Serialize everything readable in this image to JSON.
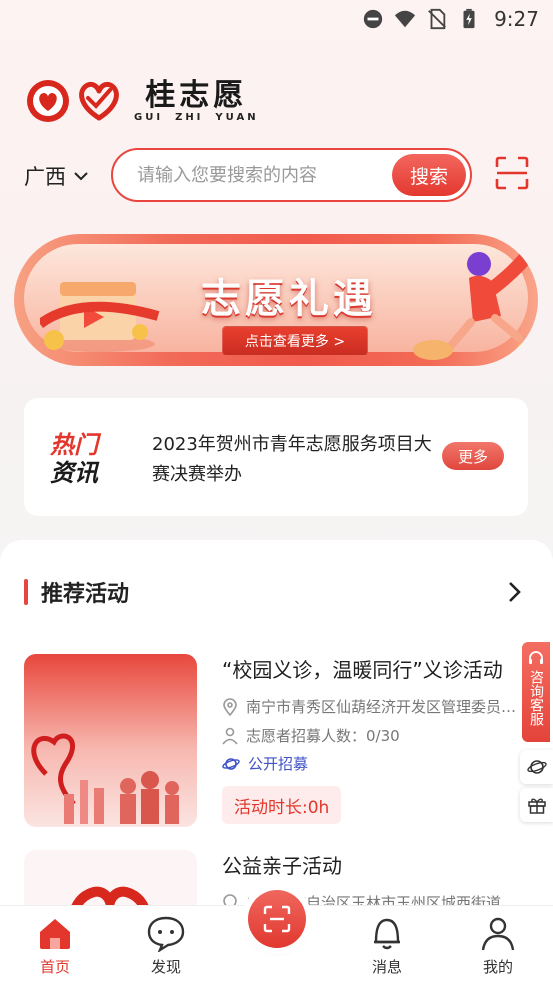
{
  "status_bar": {
    "time": "9:27"
  },
  "logo": {
    "title": "桂志愿",
    "sub": [
      "GUI",
      "ZHI",
      "YUAN"
    ]
  },
  "search": {
    "region": "广西",
    "placeholder": "请输入您要搜索的内容",
    "button_label": "搜索"
  },
  "banner": {
    "title": "志愿礼遇",
    "cta": "点击查看更多 >"
  },
  "news": {
    "logo_line1": "热门",
    "logo_line2": "资讯",
    "headline": "2023年贺州市青年志愿服务项目大赛决赛举办",
    "more_label": "更多"
  },
  "recommend": {
    "title": "推荐活动",
    "items": [
      {
        "title": "“校园义诊，温暖同行”义诊活动",
        "location": "南宁市青秀区仙葫经济开发区管理委员…",
        "recruit": "志愿者招募人数：0/30",
        "mode": "公开招募",
        "duration": "活动时长:0h"
      },
      {
        "title": "公益亲子活动",
        "location": "广西壮族自治区玉林市玉州区城西街道"
      }
    ]
  },
  "float_panel": {
    "service_label": "咨询客服"
  },
  "bottom_nav": {
    "home": "首页",
    "discover": "发现",
    "messages": "消息",
    "mine": "我的"
  },
  "colors": {
    "accent": "#e3372d",
    "link_blue": "#3f52c6"
  }
}
